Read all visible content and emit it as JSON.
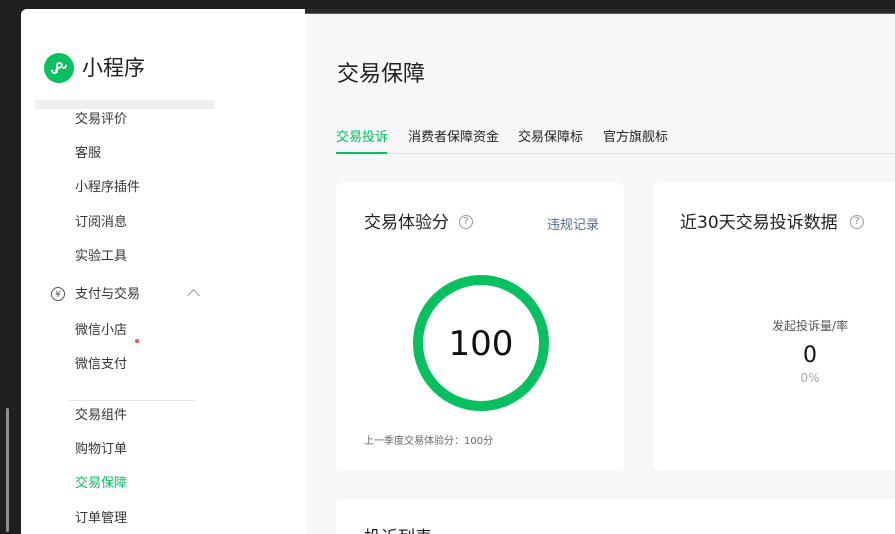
{
  "app": {
    "name": "小程序"
  },
  "sidebar": {
    "items_top": [
      {
        "label": "交易评价"
      },
      {
        "label": "客服"
      },
      {
        "label": "小程序插件"
      },
      {
        "label": "订阅消息"
      },
      {
        "label": "实验工具"
      }
    ],
    "section": {
      "label": "支付与交易",
      "icon": "yen-icon"
    },
    "items_section": [
      {
        "label": "微信小店"
      },
      {
        "label": "微信支付"
      }
    ],
    "items_bottom": [
      {
        "label": "交易组件"
      },
      {
        "label": "购物订单"
      },
      {
        "label": "交易保障"
      },
      {
        "label": "订单管理"
      }
    ]
  },
  "main": {
    "title": "交易保障",
    "tabs": [
      {
        "label": "交易投诉"
      },
      {
        "label": "消费者保障资金"
      },
      {
        "label": "交易保障标"
      },
      {
        "label": "官方旗舰标"
      }
    ]
  },
  "score_card": {
    "title": "交易体验分",
    "link": "违规记录",
    "score": "100",
    "score_fraction": 1,
    "footnote": "上一季度交易体验分：100分"
  },
  "complaint_card": {
    "title": "近30天交易投诉数据",
    "metric_label": "发起投诉量/率",
    "metric_value": "0",
    "metric_rate": "0%"
  },
  "bottom_card": {
    "title": "投诉列表"
  },
  "colors": {
    "accent": "#07c160",
    "link": "#576b95",
    "text": "#1f1f1f",
    "muted": "#666666",
    "badge": "#fa5151"
  }
}
